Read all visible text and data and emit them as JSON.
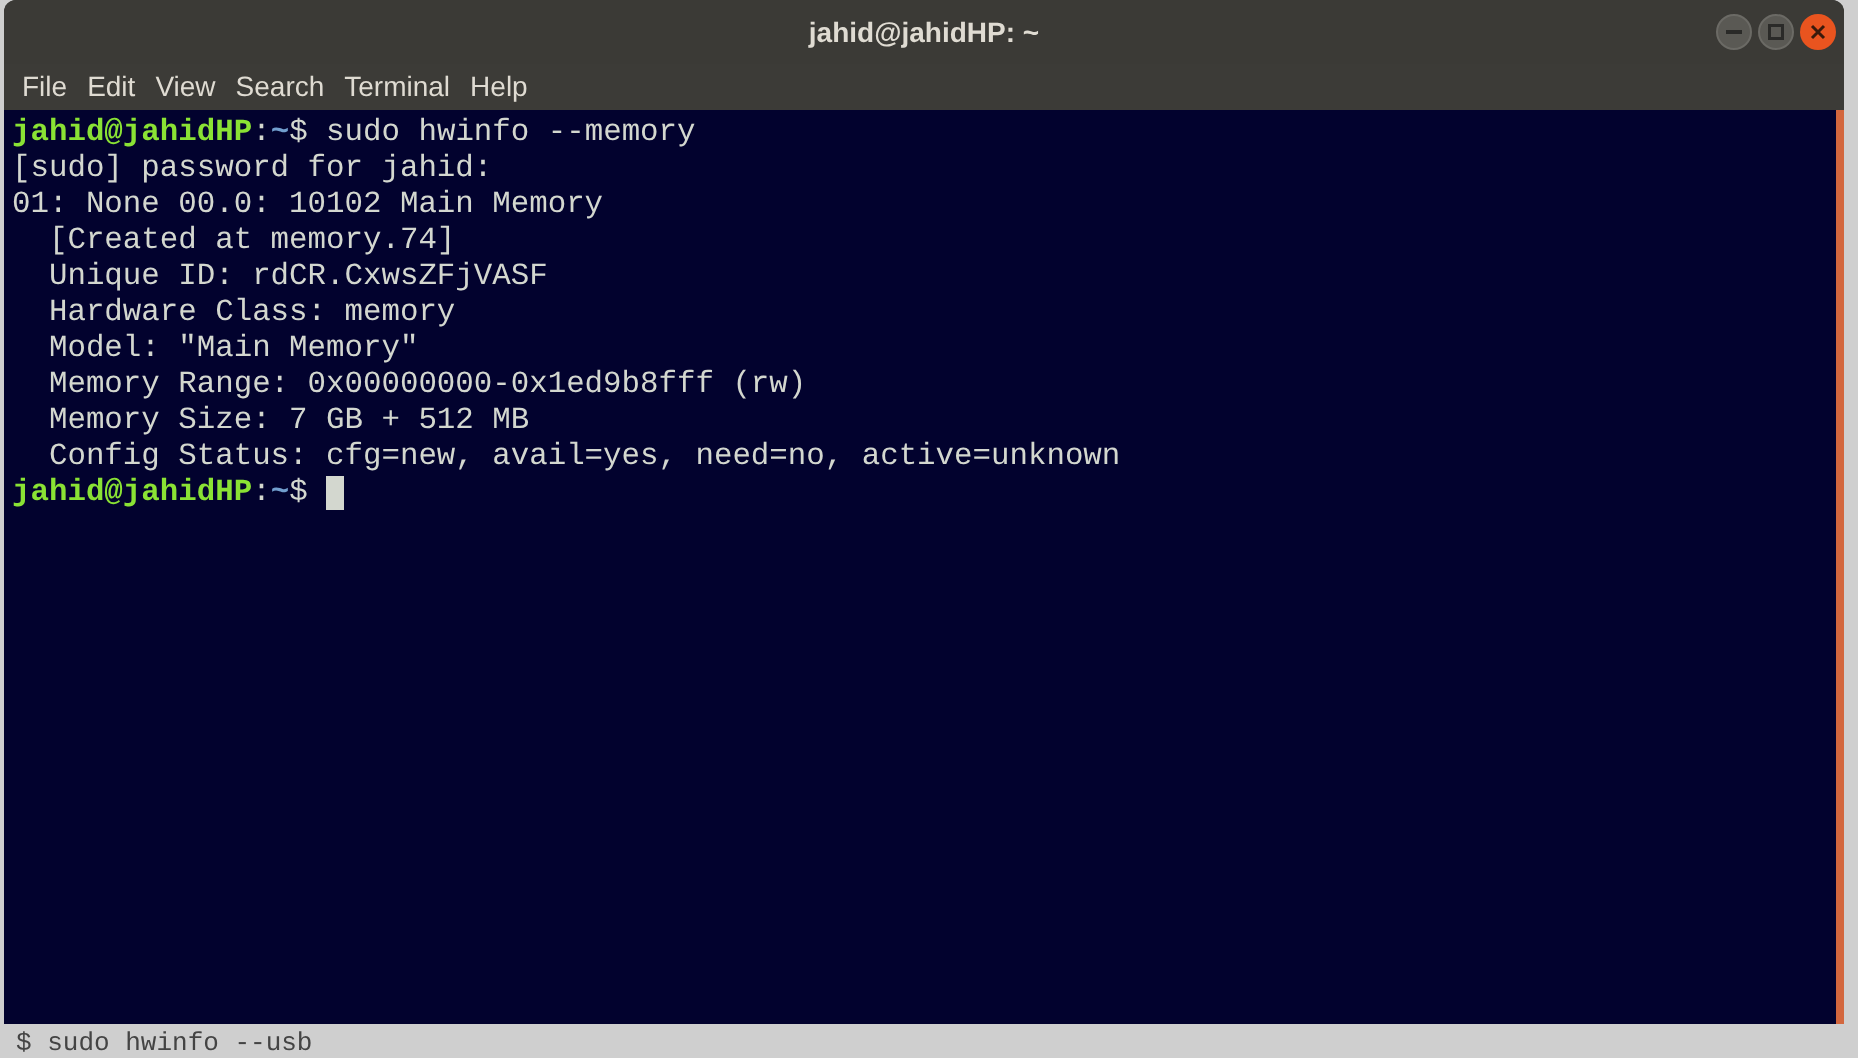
{
  "window": {
    "title": "jahid@jahidHP: ~"
  },
  "menu": [
    "File",
    "Edit",
    "View",
    "Search",
    "Terminal",
    "Help"
  ],
  "terminal": {
    "lines": [
      {
        "kind": "prompt",
        "user": "jahid@jahidHP",
        "separator": ":",
        "path": "~",
        "symbol": "$",
        "command": "sudo hwinfo --memory",
        "cursor": false
      },
      {
        "kind": "output",
        "text": "[sudo] password for jahid:"
      },
      {
        "kind": "output",
        "text": "01: None 00.0: 10102 Main Memory"
      },
      {
        "kind": "output",
        "text": "  [Created at memory.74]"
      },
      {
        "kind": "output",
        "text": "  Unique ID: rdCR.CxwsZFjVASF"
      },
      {
        "kind": "output",
        "text": "  Hardware Class: memory"
      },
      {
        "kind": "output",
        "text": "  Model: \"Main Memory\""
      },
      {
        "kind": "output",
        "text": "  Memory Range: 0x00000000-0x1ed9b8fff (rw)"
      },
      {
        "kind": "output",
        "text": "  Memory Size: 7 GB + 512 MB"
      },
      {
        "kind": "output",
        "text": "  Config Status: cfg=new, avail=yes, need=no, active=unknown"
      },
      {
        "kind": "prompt",
        "user": "jahid@jahidHP",
        "separator": ":",
        "path": "~",
        "symbol": "$",
        "cursor": true
      }
    ]
  },
  "background_text": "$ sudo hwinfo --usb"
}
